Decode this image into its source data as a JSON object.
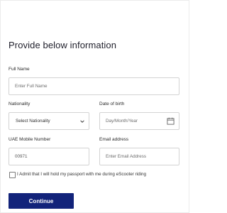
{
  "form": {
    "title": "Provide below information",
    "full_name": {
      "label": "Full Name",
      "placeholder": "Enter Full Name",
      "value": ""
    },
    "nationality": {
      "label": "Nationality",
      "selected": "Select Nationality",
      "icon": "chevron-down-icon"
    },
    "date_of_birth": {
      "label": "Date of birth",
      "placeholder": "Day/Month/Year",
      "value": "",
      "icon": "calendar-icon"
    },
    "mobile": {
      "label": "UAE Mobile Number",
      "value": "00971"
    },
    "email": {
      "label": "Email address",
      "placeholder": "Enter Email Address",
      "value": ""
    },
    "passport_checkbox": {
      "label": "I Admit that I will hold my passport with me during eScooter riding",
      "checked": false
    },
    "continue_label": "Continue"
  },
  "colors": {
    "primary_button": "#12237a",
    "field_border": "#d3d3d3"
  }
}
